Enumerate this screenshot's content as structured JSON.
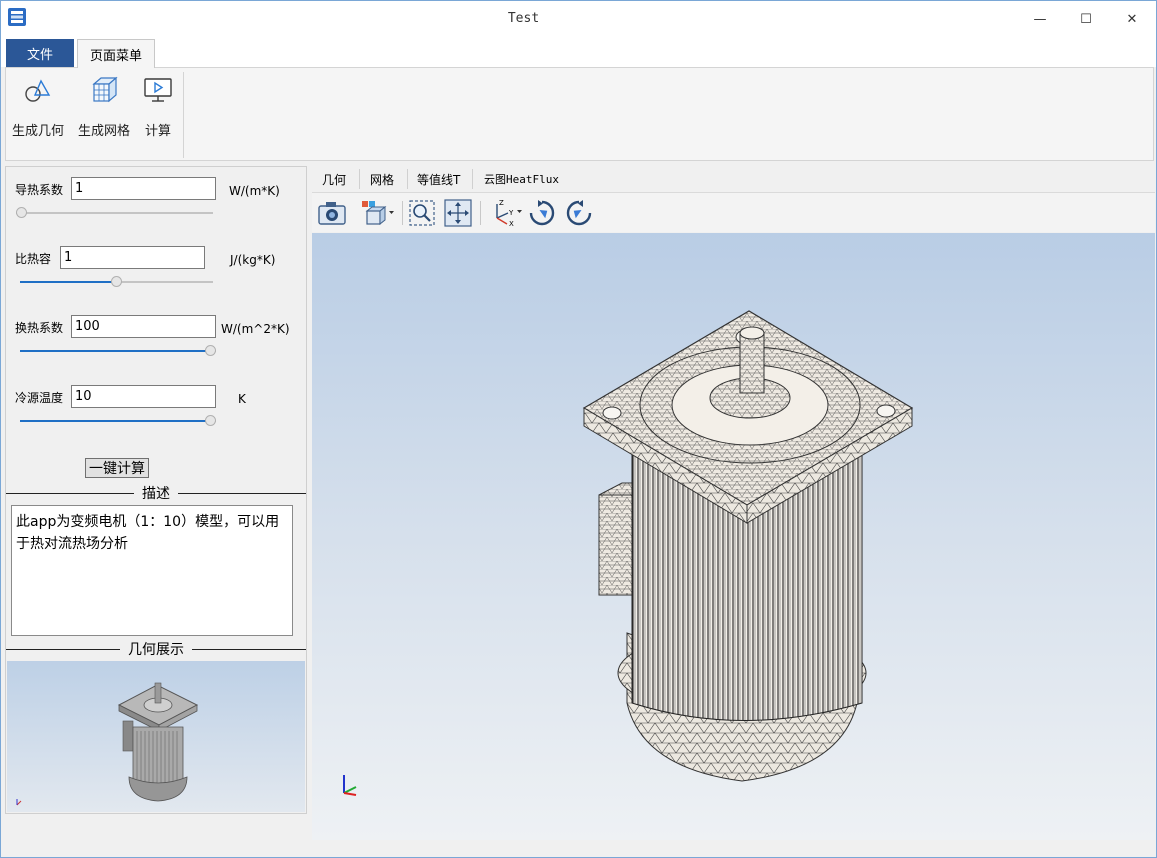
{
  "window": {
    "title": "Test",
    "minimize_glyph": "—",
    "maximize_glyph": "☐",
    "close_glyph": "✕"
  },
  "ribbon": {
    "tabs": [
      {
        "label": "文件",
        "active": false
      },
      {
        "label": "页面菜单",
        "active": true
      }
    ],
    "buttons": [
      {
        "label": "生成几何",
        "icon": "geometry-icon"
      },
      {
        "label": "生成网格",
        "icon": "mesh-icon"
      },
      {
        "label": "计算",
        "icon": "compute-icon"
      }
    ]
  },
  "params": [
    {
      "label": "导热系数",
      "value": "1",
      "unit": "W/(m*K)",
      "slider_fraction": 0.0
    },
    {
      "label": "比热容",
      "value": "1",
      "unit": "J/(kg*K)",
      "slider_fraction": 0.5
    },
    {
      "label": "换热系数",
      "value": "100",
      "unit": "W/(m^2*K)",
      "slider_fraction": 1.0
    },
    {
      "label": "冷源温度",
      "value": "10",
      "unit": "K",
      "slider_fraction": 1.0
    }
  ],
  "calc_button": "一键计算",
  "description": {
    "title": "描述",
    "text": "此app为变频电机（1：10）模型，可以用于热对流热场分析"
  },
  "geometry_preview": {
    "title": "几何展示"
  },
  "view_tabs": [
    {
      "label": "几何"
    },
    {
      "label": "网格"
    },
    {
      "label": "等值线T"
    },
    {
      "label": "云图HeatFlux"
    }
  ],
  "toolbar": {
    "buttons": [
      "camera-icon",
      "view-cube-icon",
      "zoom-box-icon",
      "fit-all-icon",
      "axes-orientation-icon",
      "rotate-cw-icon",
      "rotate-ccw-icon"
    ],
    "axis_labels": {
      "x": "X",
      "y": "Y",
      "z": "Z"
    }
  },
  "colors": {
    "accent": "#2b5797",
    "slider_fill": "#1f6fc5",
    "viewport_top": "#b9cde5",
    "viewport_bottom": "#eef1f4"
  }
}
